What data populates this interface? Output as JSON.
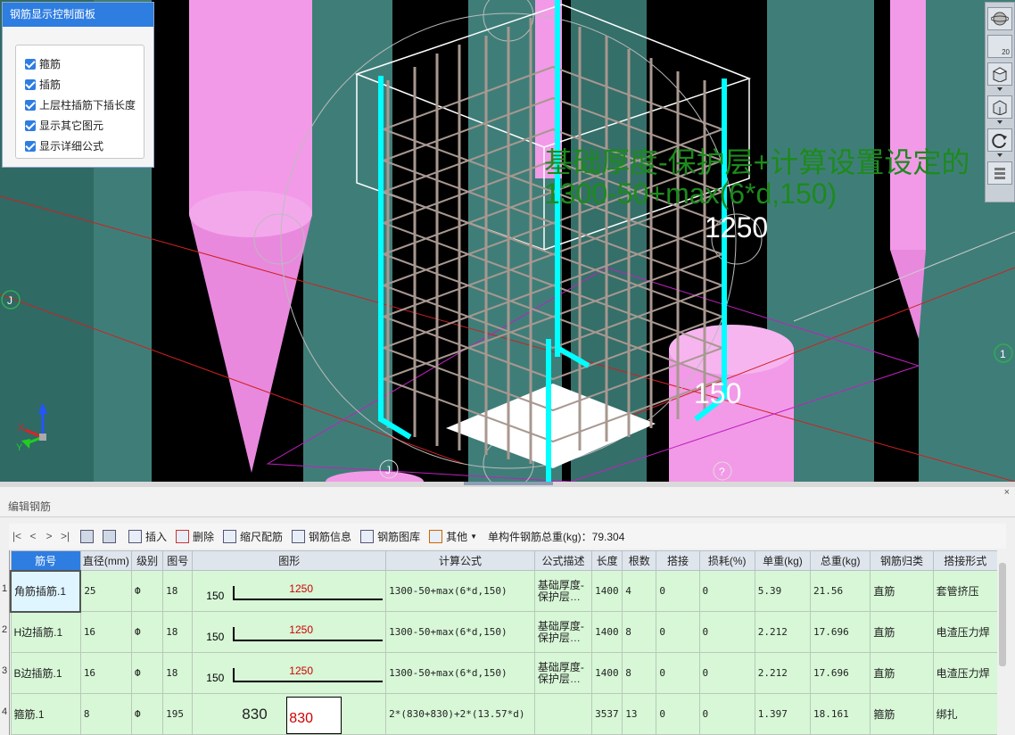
{
  "control_panel": {
    "title": "钢筋显示控制面板",
    "options": [
      {
        "label": "箍筋",
        "checked": true
      },
      {
        "label": "插筋",
        "checked": true
      },
      {
        "label": "上层柱插筋下插长度",
        "checked": true
      },
      {
        "label": "显示其它图元",
        "checked": true
      },
      {
        "label": "显示详细公式",
        "checked": true
      }
    ]
  },
  "viewport": {
    "formula_line1": "基础厚度-保护层+计算设置设定的",
    "formula_line2": "1300-50+max(6*d,150)",
    "dim_1250": "1250",
    "dim_150": "150",
    "axis_left": "J",
    "axis_right": "1",
    "axis_bottom1": "J",
    "axis_bottom2": "?",
    "axes": {
      "x": "X",
      "y": "Y",
      "z": "Z"
    },
    "colors": {
      "background": "#000000",
      "column": "#3f7e78",
      "pink": "#f29ae8",
      "cyan": "#00ffff",
      "rebar": "#a89890",
      "formula": "#1d8a1d"
    }
  },
  "right_toolbar": {
    "buttons": [
      {
        "icon": "globe-icon"
      },
      {
        "icon": "plane-icon",
        "label": "20"
      },
      {
        "icon": "cube-top-icon"
      },
      {
        "icon": "cube-side-icon"
      },
      {
        "icon": "rotate-icon"
      },
      {
        "icon": "layers-icon"
      }
    ]
  },
  "edit_panel": {
    "title": "编辑钢筋",
    "close": "×",
    "toolbar": {
      "nav": [
        "|<",
        "<",
        ">",
        ">|"
      ],
      "insert": "插入",
      "delete": "删除",
      "scale_rebar": "缩尺配筋",
      "rebar_info": "钢筋信息",
      "rebar_library": "钢筋图库",
      "other": "其他",
      "total_label": "单构件钢筋总重(kg)：79.304"
    },
    "columns": [
      "筋号",
      "直径(mm)",
      "级别",
      "图号",
      "图形",
      "计算公式",
      "公式描述",
      "长度",
      "根数",
      "搭接",
      "损耗(%)",
      "单重(kg)",
      "总重(kg)",
      "钢筋归类",
      "搭接形式"
    ],
    "rows": [
      {
        "num": "1",
        "name": "角筋插筋.1",
        "dia": "25",
        "grade": "Ф",
        "fig": "18",
        "shape_left": "150",
        "shape_top": "1250",
        "formula": "1300-50+max(6*d,150)",
        "desc": "基础厚度-保护层…",
        "length": "1400",
        "count": "4",
        "lap": "0",
        "loss": "0",
        "unit_w": "5.39",
        "total_w": "21.56",
        "type": "直筋",
        "lap_type": "套管挤压"
      },
      {
        "num": "2",
        "name": "H边插筋.1",
        "dia": "16",
        "grade": "Ф",
        "fig": "18",
        "shape_left": "150",
        "shape_top": "1250",
        "formula": "1300-50+max(6*d,150)",
        "desc": "基础厚度-保护层…",
        "length": "1400",
        "count": "8",
        "lap": "0",
        "loss": "0",
        "unit_w": "2.212",
        "total_w": "17.696",
        "type": "直筋",
        "lap_type": "电渣压力焊"
      },
      {
        "num": "3",
        "name": "B边插筋.1",
        "dia": "16",
        "grade": "Ф",
        "fig": "18",
        "shape_left": "150",
        "shape_top": "1250",
        "formula": "1300-50+max(6*d,150)",
        "desc": "基础厚度-保护层…",
        "length": "1400",
        "count": "8",
        "lap": "0",
        "loss": "0",
        "unit_w": "2.212",
        "total_w": "17.696",
        "type": "直筋",
        "lap_type": "电渣压力焊"
      },
      {
        "num": "4",
        "name": "箍筋.1",
        "dia": "8",
        "grade": "Ф",
        "fig": "195",
        "shape_left": "830",
        "shape_top": "830",
        "formula": "2*(830+830)+2*(13.57*d)",
        "desc": "",
        "length": "3537",
        "count": "13",
        "lap": "0",
        "loss": "0",
        "unit_w": "1.397",
        "total_w": "18.161",
        "type": "箍筋",
        "lap_type": "绑扎"
      }
    ]
  }
}
